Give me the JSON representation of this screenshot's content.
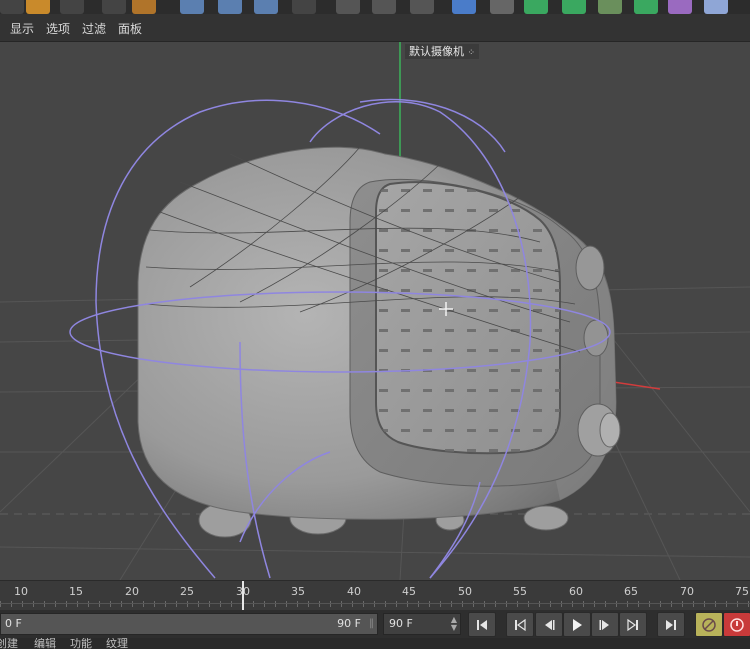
{
  "menu": {
    "items": [
      "显示",
      "选项",
      "过滤",
      "面板"
    ]
  },
  "viewport": {
    "camera_label": "默认摄像机",
    "camera_icon": "camera-dots-icon",
    "accent_axis_green": "#3cb35a",
    "accent_axis_red": "#d23c3c",
    "gizmo_color": "#8f86e0"
  },
  "timeline": {
    "ticks": [
      "10",
      "15",
      "20",
      "25",
      "30",
      "35",
      "40",
      "45",
      "50",
      "55",
      "60",
      "65",
      "70",
      "75"
    ],
    "current_frame": 30
  },
  "transport": {
    "range_start": "0 F",
    "range_end": "90 F",
    "frame_field": "90 F",
    "buttons": [
      "go-start-icon",
      "prev-key-icon",
      "prev-frame-icon",
      "play-icon",
      "next-frame-icon",
      "next-key-icon",
      "go-end-icon",
      "record-icon",
      "autokey-icon"
    ]
  },
  "statusbar": {
    "items": [
      "创建",
      "编辑",
      "功能",
      "纹理"
    ]
  },
  "toolbar": {
    "active_color": "#5b7fb0"
  }
}
